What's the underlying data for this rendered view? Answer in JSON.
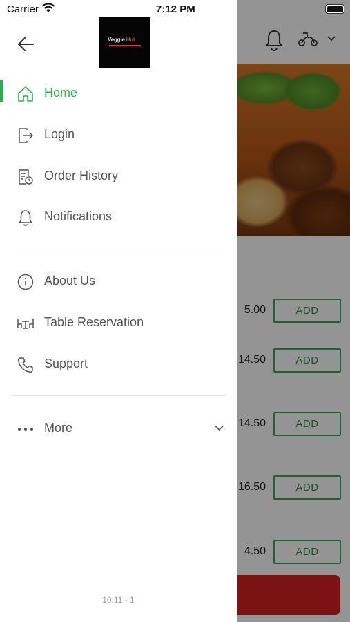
{
  "status_bar": {
    "carrier": "Carrier",
    "time": "7:12 PM"
  },
  "drawer": {
    "logo": {
      "line1": "Veggie",
      "line2": "Hut"
    },
    "menu_items": [
      {
        "label": "Home",
        "icon": "home-icon",
        "active": true
      },
      {
        "label": "Login",
        "icon": "login-icon"
      },
      {
        "label": "Order History",
        "icon": "order-history-icon"
      },
      {
        "label": "Notifications",
        "icon": "bell-icon"
      },
      {
        "label": "About Us",
        "icon": "info-icon"
      },
      {
        "label": "Table Reservation",
        "icon": "table-icon"
      },
      {
        "label": "Support",
        "icon": "phone-icon"
      },
      {
        "label": "More",
        "icon": "more-dots-icon"
      }
    ],
    "version": "10.11 - 1"
  },
  "background": {
    "items": [
      {
        "price": "5.00",
        "button": "ADD"
      },
      {
        "price": "14.50",
        "button": "ADD"
      },
      {
        "price": "14.50",
        "button": "ADD"
      },
      {
        "price": "16.50",
        "button": "ADD"
      },
      {
        "price": "4.50",
        "button": "ADD"
      }
    ]
  },
  "colors": {
    "accent": "#27b24a",
    "cta": "#d42222",
    "add_border": "#3aa55a"
  }
}
